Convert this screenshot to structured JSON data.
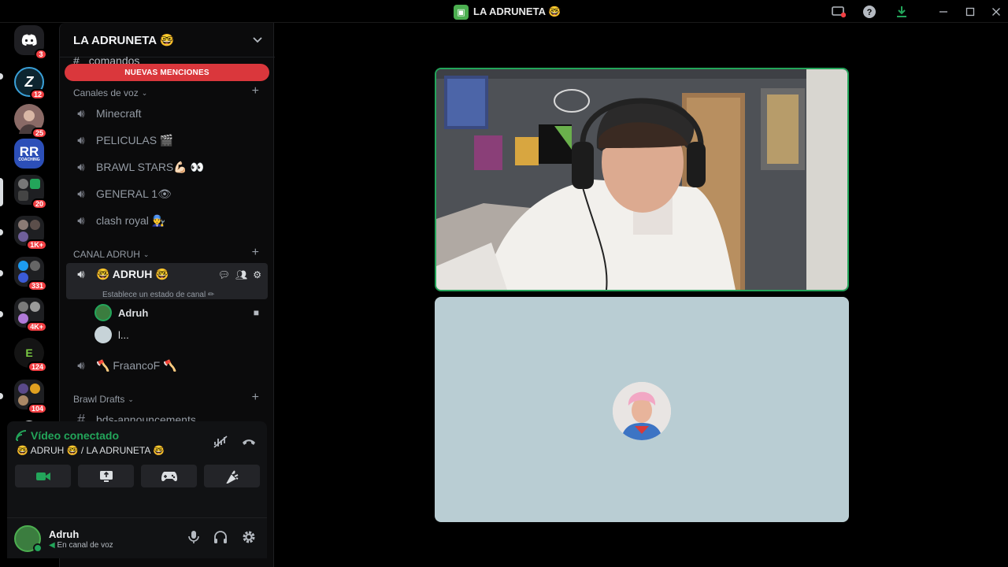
{
  "window": {
    "title": "LA ADRUNETA 🤓",
    "controls": [
      "screen-share-icon",
      "help-icon",
      "download-icon",
      "minimize-icon",
      "maximize-icon",
      "close-icon"
    ]
  },
  "guilds": [
    {
      "name": "discord-home",
      "badge": "3"
    },
    {
      "name": "guild-z",
      "badge": "12"
    },
    {
      "name": "guild-avatar-1",
      "badge": "25"
    },
    {
      "name": "guild-rr-coaching",
      "label": "RR",
      "sub": "COACHING",
      "badge": ""
    },
    {
      "name": "guild-folder-1",
      "badge": "20"
    },
    {
      "name": "guild-folder-2",
      "badge": "1K+"
    },
    {
      "name": "guild-folder-3",
      "badge": "331"
    },
    {
      "name": "guild-folder-4",
      "badge": "4K+"
    },
    {
      "name": "guild-e",
      "badge": "124"
    },
    {
      "name": "guild-folder-5",
      "badge": "104"
    }
  ],
  "sidebar": {
    "server_name": "LA ADRUNETA 🤓",
    "partial_channel": "comandos",
    "mentions_banner": "NUEVAS MENCIONES",
    "voice_category": "Canales de voz",
    "voice_channels": [
      "Minecraft",
      "PELICULAS 🎬",
      "BRAWL STARS💪🏻 👀",
      "GENERAL 1👁",
      "clash royal 👨‍🔧"
    ],
    "adruh_category": "CANAL ADRUH",
    "active_channel": "🤓 ADRUH 🤓",
    "channel_status": "Establece un estado de canal ✏",
    "voice_users": [
      "Adruh",
      "l..."
    ],
    "other_channel": "🪓 FraancoF 🪓",
    "brawl_category": "Brawl Drafts",
    "text_channel": "bds-announcements"
  },
  "voice_panel": {
    "status": "Vídeo conectado",
    "location": "🤓 ADRUH 🤓  / LA ADRUNETA 🤓"
  },
  "user_panel": {
    "name": "Adruh",
    "status": "En canal de voz"
  },
  "colors": {
    "accent_green": "#23a55a",
    "mention_red": "#da373c",
    "badge_red": "#f23f43"
  }
}
